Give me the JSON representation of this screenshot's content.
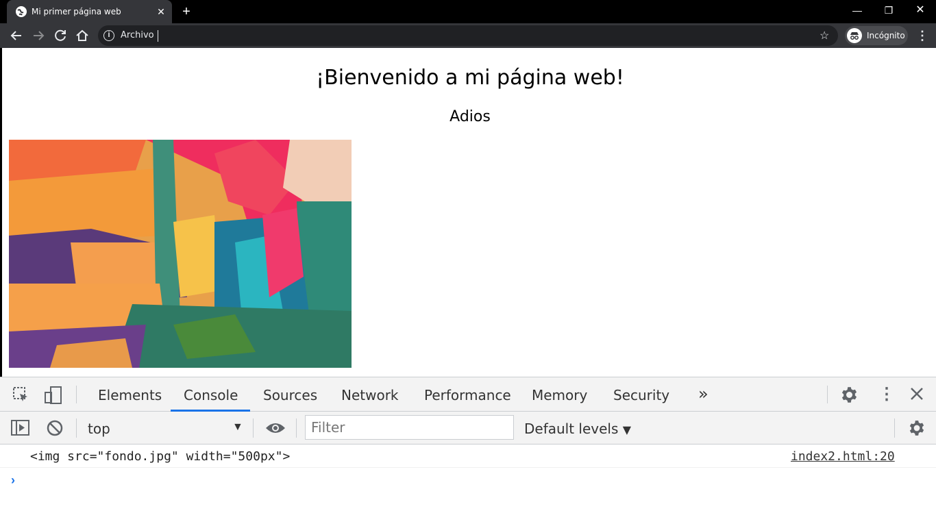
{
  "browser": {
    "tab_title": "Mi primer página web",
    "new_tab_symbol": "+",
    "address": "Archivo",
    "incognito_label": "Incógnito"
  },
  "page": {
    "heading": "¡Bienvenido a mi página web!",
    "subheading": "Adios",
    "image_alt": "abstract colorful painting"
  },
  "devtools": {
    "tabs": [
      "Elements",
      "Console",
      "Sources",
      "Network",
      "Performance",
      "Memory",
      "Security"
    ],
    "active_tab": "Console",
    "more_tabs_symbol": "»",
    "context": "top",
    "filter_placeholder": "Filter",
    "levels": "Default levels",
    "console_message": "<img src=\"fondo.jpg\" width=\"500px\">",
    "console_source": "index2.html:20",
    "prompt_symbol": "›"
  },
  "colors": {
    "tabstrip": "#000000",
    "toolbar": "#35363a",
    "omnibox": "#202124",
    "devtools_accent": "#1a73e8"
  }
}
